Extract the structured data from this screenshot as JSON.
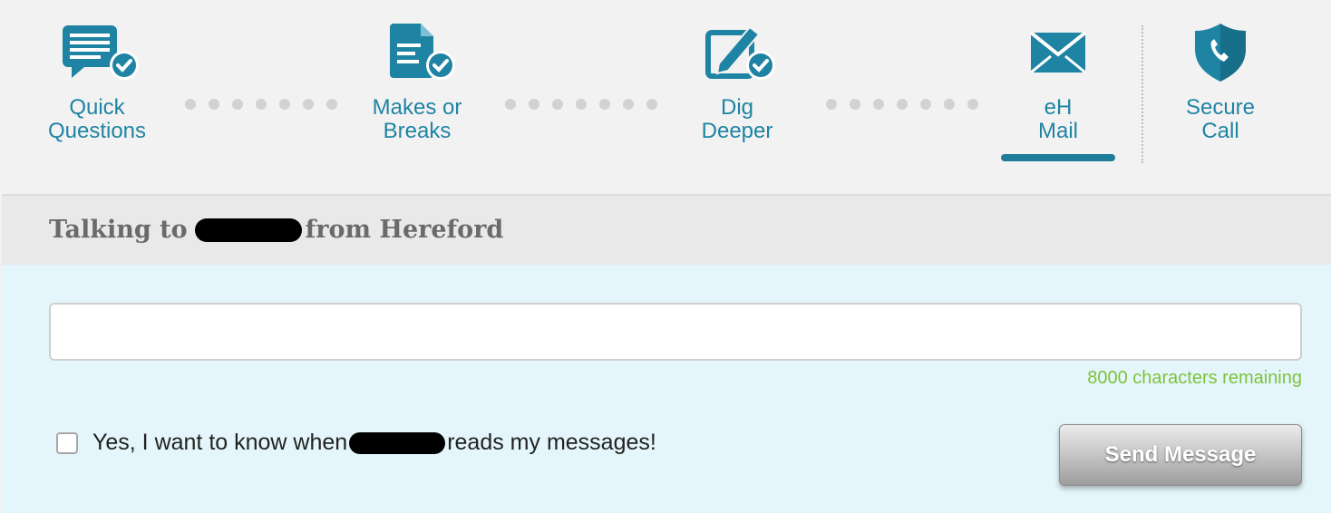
{
  "steps": [
    {
      "line1": "Quick",
      "line2": "Questions",
      "icon": "speech-bubble-check-icon",
      "completed": true
    },
    {
      "line1": "Makes or",
      "line2": "Breaks",
      "icon": "document-check-icon",
      "completed": true
    },
    {
      "line1": "Dig",
      "line2": "Deeper",
      "icon": "pencil-check-icon",
      "completed": true
    },
    {
      "line1": "eH",
      "line2": "Mail",
      "icon": "envelope-icon",
      "active": true
    },
    {
      "line1": "Secure",
      "line2": "Call",
      "icon": "shield-phone-icon"
    }
  ],
  "conversation": {
    "title_prefix": "Talking to",
    "title_suffix": "from Hereford"
  },
  "compose": {
    "message_value": "",
    "char_count": "8000 characters remaining",
    "read_receipt_prefix": "Yes, I want to know when",
    "read_receipt_suffix": "reads my messages!",
    "send_label": "Send Message"
  },
  "colors": {
    "accent": "#1f84a3",
    "active_bar": "#1f7d99",
    "char_count": "#7ec33a",
    "compose_bg": "#e4f6fb"
  }
}
